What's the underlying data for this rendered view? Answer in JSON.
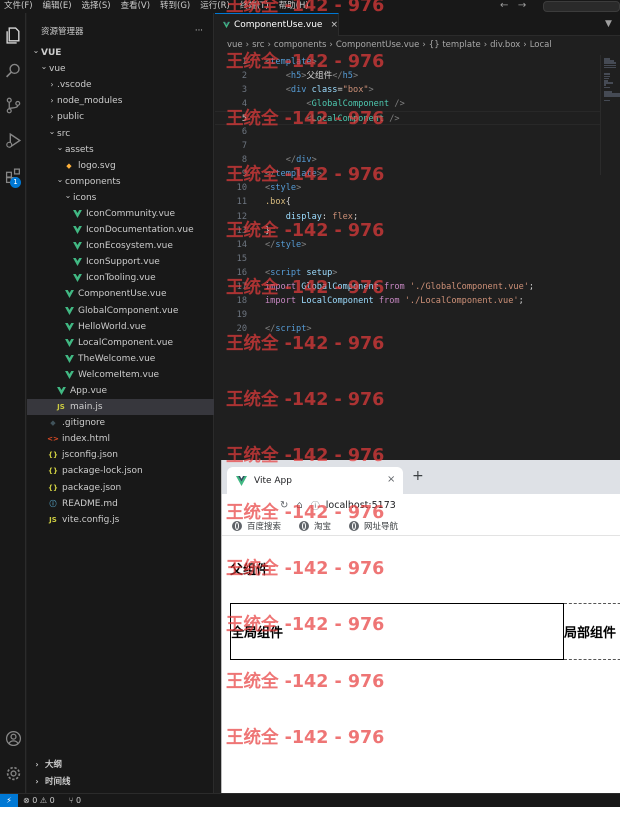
{
  "menubar": {
    "items": [
      "文件(F)",
      "编辑(E)",
      "选择(S)",
      "查看(V)",
      "转到(G)",
      "运行(R)",
      "终端(T)",
      "帮助(H)"
    ]
  },
  "activity": {
    "badge": "1",
    "icons": [
      "explorer-icon",
      "search-icon",
      "source-control-icon",
      "run-debug-icon",
      "extensions-icon",
      "account-icon",
      "gear-icon"
    ]
  },
  "sidebar": {
    "title": "资源管理器",
    "more": "···",
    "tree": [
      {
        "label": "VUE",
        "indent": 0,
        "chev": "v",
        "icon": "",
        "bold": true
      },
      {
        "label": "vue",
        "indent": 1,
        "chev": "v",
        "icon": ""
      },
      {
        "label": ".vscode",
        "indent": 2,
        "chev": ">",
        "icon": ""
      },
      {
        "label": "node_modules",
        "indent": 2,
        "chev": ">",
        "icon": ""
      },
      {
        "label": "public",
        "indent": 2,
        "chev": ">",
        "icon": ""
      },
      {
        "label": "src",
        "indent": 2,
        "chev": "v",
        "icon": ""
      },
      {
        "label": "assets",
        "indent": 3,
        "chev": "v",
        "icon": ""
      },
      {
        "label": "logo.svg",
        "indent": 4,
        "chev": "",
        "icon": "svg"
      },
      {
        "label": "components",
        "indent": 3,
        "chev": "v",
        "icon": ""
      },
      {
        "label": "icons",
        "indent": 4,
        "chev": "v",
        "icon": ""
      },
      {
        "label": "IconCommunity.vue",
        "indent": 5,
        "chev": "",
        "icon": "vue"
      },
      {
        "label": "IconDocumentation.vue",
        "indent": 5,
        "chev": "",
        "icon": "vue"
      },
      {
        "label": "IconEcosystem.vue",
        "indent": 5,
        "chev": "",
        "icon": "vue"
      },
      {
        "label": "IconSupport.vue",
        "indent": 5,
        "chev": "",
        "icon": "vue"
      },
      {
        "label": "IconTooling.vue",
        "indent": 5,
        "chev": "",
        "icon": "vue"
      },
      {
        "label": "ComponentUse.vue",
        "indent": 4,
        "chev": "",
        "icon": "vue"
      },
      {
        "label": "GlobalComponent.vue",
        "indent": 4,
        "chev": "",
        "icon": "vue"
      },
      {
        "label": "HelloWorld.vue",
        "indent": 4,
        "chev": "",
        "icon": "vue"
      },
      {
        "label": "LocalComponent.vue",
        "indent": 4,
        "chev": "",
        "icon": "vue"
      },
      {
        "label": "TheWelcome.vue",
        "indent": 4,
        "chev": "",
        "icon": "vue"
      },
      {
        "label": "WelcomeItem.vue",
        "indent": 4,
        "chev": "",
        "icon": "vue"
      },
      {
        "label": "App.vue",
        "indent": 3,
        "chev": "",
        "icon": "vue"
      },
      {
        "label": "main.js",
        "indent": 3,
        "chev": "",
        "icon": "js",
        "selected": true
      },
      {
        "label": ".gitignore",
        "indent": 2,
        "chev": "",
        "icon": "git"
      },
      {
        "label": "index.html",
        "indent": 2,
        "chev": "",
        "icon": "html"
      },
      {
        "label": "jsconfig.json",
        "indent": 2,
        "chev": "",
        "icon": "json"
      },
      {
        "label": "package-lock.json",
        "indent": 2,
        "chev": "",
        "icon": "json"
      },
      {
        "label": "package.json",
        "indent": 2,
        "chev": "",
        "icon": "json"
      },
      {
        "label": "README.md",
        "indent": 2,
        "chev": "",
        "icon": "info"
      },
      {
        "label": "vite.config.js",
        "indent": 2,
        "chev": "",
        "icon": "js"
      }
    ],
    "outline": "大纲",
    "timeline": "时间线"
  },
  "icon_glyphs": {
    "svg": "◆",
    "js": "JS",
    "git": "◆",
    "html": "<>",
    "json": "{}",
    "info": "ⓘ"
  },
  "icon_colors": {
    "svg": "#ffb13b",
    "js": "#cbcb41",
    "git": "#41535b",
    "html": "#e44d26",
    "json": "#cbcb41",
    "info": "#519aba",
    "vue": "#41b883"
  },
  "editor": {
    "tab_label": "ComponentUse.vue",
    "tab_close": "×",
    "breadcrumb": [
      "vue",
      ">",
      "src",
      ">",
      "components",
      ">",
      "ComponentUse.vue",
      ">",
      "{} template",
      ">",
      "div.box",
      ">",
      "Local"
    ],
    "current_line": 5,
    "lines": [
      [
        [
          "tk-bracket",
          "<"
        ],
        [
          "tk-tag",
          "template"
        ],
        [
          "tk-bracket",
          ">"
        ]
      ],
      [
        [
          "tk-punc",
          "    "
        ],
        [
          "tk-bracket",
          "<"
        ],
        [
          "tk-tag",
          "h5"
        ],
        [
          "tk-bracket",
          ">"
        ],
        [
          "tk-text",
          "父组件"
        ],
        [
          "tk-bracket",
          "</"
        ],
        [
          "tk-tag",
          "h5"
        ],
        [
          "tk-bracket",
          ">"
        ]
      ],
      [
        [
          "tk-punc",
          "    "
        ],
        [
          "tk-bracket",
          "<"
        ],
        [
          "tk-tag",
          "div"
        ],
        [
          "tk-punc",
          " "
        ],
        [
          "tk-attr",
          "class"
        ],
        [
          "tk-punc",
          "="
        ],
        [
          "tk-str",
          "\"box\""
        ],
        [
          "tk-bracket",
          ">"
        ]
      ],
      [
        [
          "tk-punc",
          "        "
        ],
        [
          "tk-bracket",
          "<"
        ],
        [
          "tk-comp",
          "GlobalComponent"
        ],
        [
          "tk-punc",
          " "
        ],
        [
          "tk-bracket",
          "/>"
        ]
      ],
      [
        [
          "tk-punc",
          "        "
        ],
        [
          "tk-bracket",
          "<"
        ],
        [
          "tk-comp",
          "LocalComponent"
        ],
        [
          "tk-punc",
          " "
        ],
        [
          "tk-bracket",
          "/>"
        ]
      ],
      [],
      [],
      [
        [
          "tk-punc",
          "    "
        ],
        [
          "tk-bracket",
          "</"
        ],
        [
          "tk-tag",
          "div"
        ],
        [
          "tk-bracket",
          ">"
        ]
      ],
      [
        [
          "tk-bracket",
          "</"
        ],
        [
          "tk-tag",
          "template"
        ],
        [
          "tk-bracket",
          ">"
        ]
      ],
      [
        [
          "tk-bracket",
          "<"
        ],
        [
          "tk-tag",
          "style"
        ],
        [
          "tk-bracket",
          ">"
        ]
      ],
      [
        [
          "tk-sel",
          ".box"
        ],
        [
          "tk-punc",
          "{"
        ]
      ],
      [
        [
          "tk-punc",
          "    "
        ],
        [
          "tk-prop",
          "display"
        ],
        [
          "tk-punc",
          ": "
        ],
        [
          "tk-val",
          "flex"
        ],
        [
          "tk-punc",
          ";"
        ]
      ],
      [
        [
          "tk-punc",
          "}"
        ]
      ],
      [
        [
          "tk-bracket",
          "</"
        ],
        [
          "tk-tag",
          "style"
        ],
        [
          "tk-bracket",
          ">"
        ]
      ],
      [],
      [
        [
          "tk-bracket",
          "<"
        ],
        [
          "tk-tag",
          "script"
        ],
        [
          "tk-punc",
          " "
        ],
        [
          "tk-attr",
          "setup"
        ],
        [
          "tk-bracket",
          ">"
        ]
      ],
      [
        [
          "tk-kw",
          "import"
        ],
        [
          "tk-punc",
          " "
        ],
        [
          "tk-attr",
          "GlobalComponent"
        ],
        [
          "tk-punc",
          " "
        ],
        [
          "tk-kw",
          "from"
        ],
        [
          "tk-punc",
          " "
        ],
        [
          "tk-str",
          "'./GlobalComponent.vue'"
        ],
        [
          "tk-punc",
          ";"
        ]
      ],
      [
        [
          "tk-kw",
          "import"
        ],
        [
          "tk-punc",
          " "
        ],
        [
          "tk-attr",
          "LocalComponent"
        ],
        [
          "tk-punc",
          " "
        ],
        [
          "tk-kw",
          "from"
        ],
        [
          "tk-punc",
          " "
        ],
        [
          "tk-str",
          "'./LocalComponent.vue'"
        ],
        [
          "tk-punc",
          ";"
        ]
      ],
      [],
      [
        [
          "tk-bracket",
          "</"
        ],
        [
          "tk-tag",
          "script"
        ],
        [
          "tk-bracket",
          ">"
        ]
      ]
    ]
  },
  "browser": {
    "tab_title": "Vite App",
    "tab_close": "×",
    "new_tab": "+",
    "url": "localhost:5173",
    "bookmarks": [
      "百度搜索",
      "淘宝",
      "网址导航"
    ],
    "page": {
      "heading": "父组件",
      "global_component": "全局组件",
      "local_component": "局部组件"
    }
  },
  "statusbar": {
    "remote": "⚡",
    "problems": "⊗ 0 ⚠ 0",
    "ports": "⑂ 0"
  },
  "watermark": "王统全 -142 - 976"
}
